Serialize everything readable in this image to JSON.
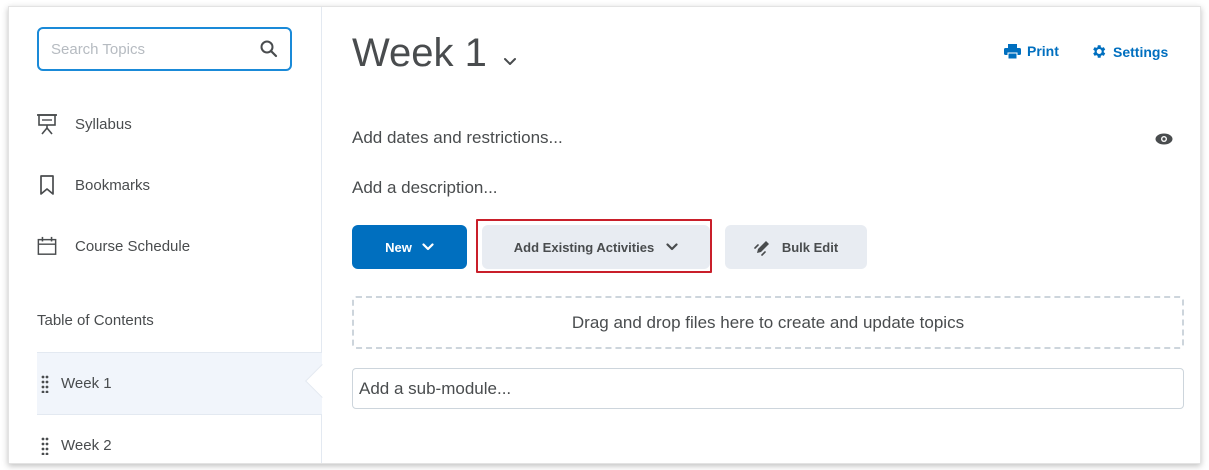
{
  "search": {
    "placeholder": "Search Topics"
  },
  "sidebar": {
    "items": [
      {
        "label": "Syllabus",
        "icon": "presentation-board-icon"
      },
      {
        "label": "Bookmarks",
        "icon": "bookmark-icon"
      },
      {
        "label": "Course Schedule",
        "icon": "calendar-icon"
      }
    ],
    "toc_heading": "Table of Contents",
    "weeks": [
      {
        "label": "Week 1",
        "active": true
      },
      {
        "label": "Week 2",
        "active": false
      }
    ]
  },
  "main": {
    "title": "Week 1",
    "print_label": "Print",
    "settings_label": "Settings",
    "dates_label": "Add dates and restrictions...",
    "description_label": "Add a description...",
    "new_label": "New",
    "add_existing_label": "Add Existing Activities",
    "bulk_edit_label": "Bulk Edit",
    "dropzone_text": "Drag and drop files here to create and update topics",
    "submodule_label": "Add a sub-module..."
  },
  "colors": {
    "primary": "#006fbf",
    "search_border": "#1a8ad8",
    "highlight": "#c91f2a",
    "button_secondary": "#e8ecf2"
  }
}
